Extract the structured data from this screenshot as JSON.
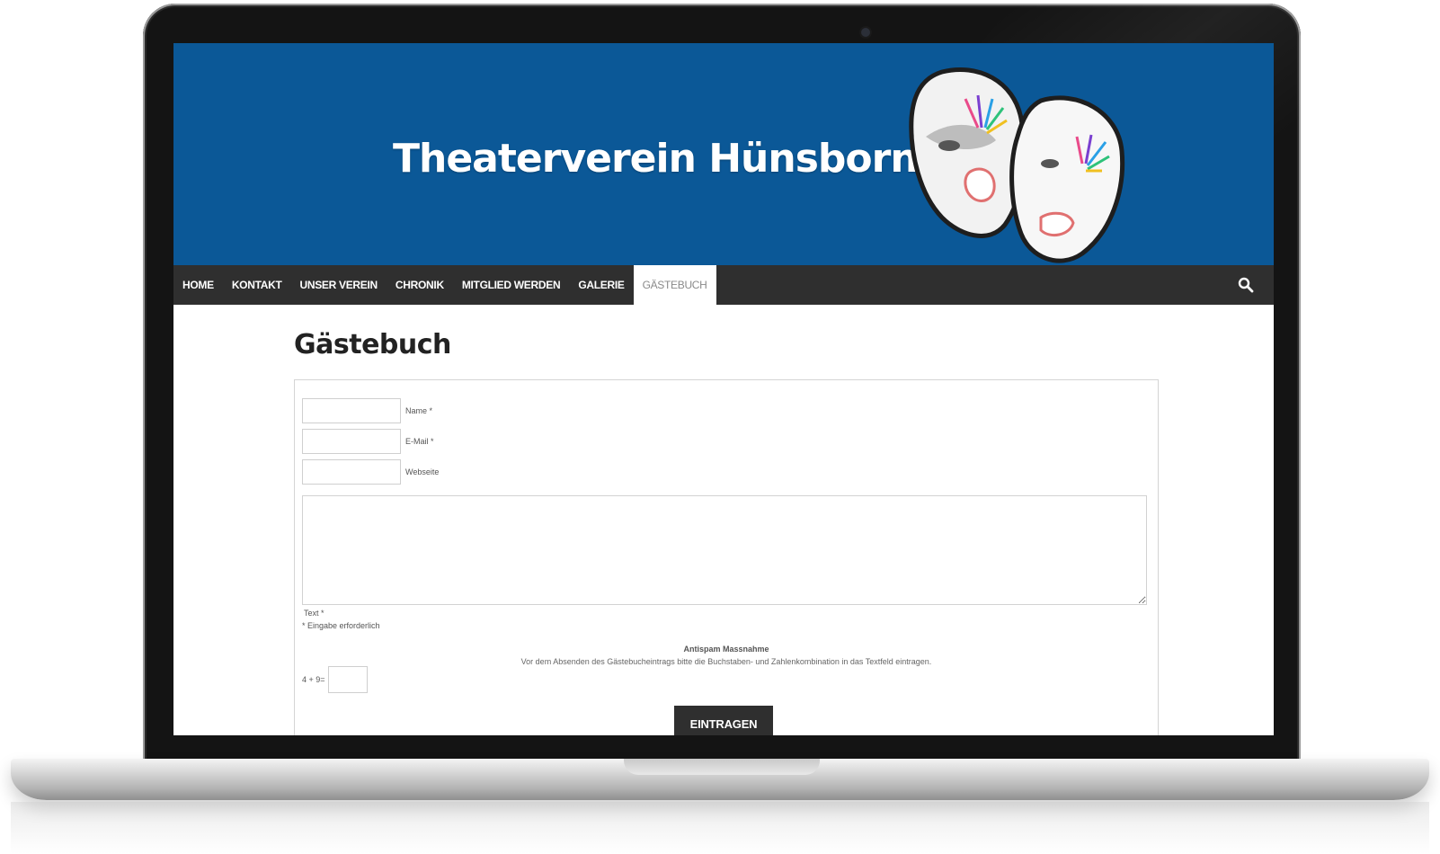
{
  "site": {
    "title": "Theaterverein Hünsborn",
    "header_color": "#0b5897",
    "logo_icon": "theater-masks-icon"
  },
  "nav": {
    "items": [
      {
        "label": "HOME",
        "active": false
      },
      {
        "label": "KONTAKT",
        "active": false
      },
      {
        "label": "UNSER VEREIN",
        "active": false
      },
      {
        "label": "CHRONIK",
        "active": false
      },
      {
        "label": "MITGLIED WERDEN",
        "active": false
      },
      {
        "label": "GALERIE",
        "active": false
      },
      {
        "label": "GÄSTEBUCH",
        "active": true
      }
    ],
    "search_icon": "search-icon"
  },
  "page": {
    "title": "Gästebuch"
  },
  "form": {
    "name_label": "Name *",
    "email_label": "E-Mail *",
    "website_label": "Webseite",
    "text_label": "Text *",
    "required_note": "* Eingabe erforderlich",
    "antispam_title": "Antispam Massnahme",
    "antispam_text": "Vor dem Absenden des Gästebucheintrags bitte die Buchstaben- und Zahlenkombination in das Textfeld eintragen.",
    "captcha_question": "4 + 9=",
    "submit_label": "EINTRAGEN"
  }
}
